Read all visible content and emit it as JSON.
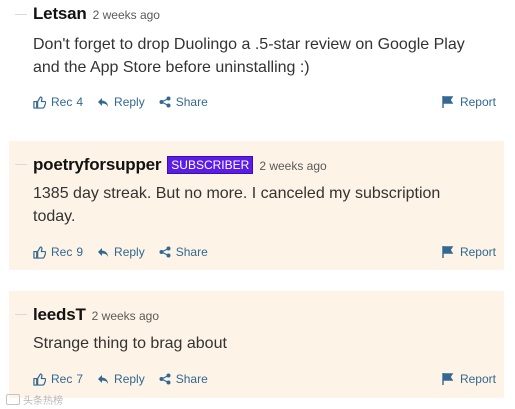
{
  "comments": [
    {
      "username": "Letsan",
      "badge": "",
      "timestamp": "2 weeks ago",
      "text": "Don't forget to drop Duolingo a .5-star review on Google Play and the App Store before uninstalling :)",
      "rec_label": "Rec",
      "rec_count": "4",
      "reply_label": "Reply",
      "share_label": "Share",
      "report_label": "Report"
    },
    {
      "username": "poetryforsupper",
      "badge": "SUBSCRIBER",
      "timestamp": "2 weeks ago",
      "text": "1385 day streak. But no more. I canceled my subscription today.",
      "rec_label": "Rec",
      "rec_count": "9",
      "reply_label": "Reply",
      "share_label": "Share",
      "report_label": "Report"
    },
    {
      "username": "leedsT",
      "badge": "",
      "timestamp": "2 weeks ago",
      "text": "Strange thing to brag about",
      "rec_label": "Rec",
      "rec_count": "7",
      "reply_label": "Reply",
      "share_label": "Share",
      "report_label": "Report"
    }
  ],
  "watermark": "头条热榜",
  "colors": {
    "accent_link": "#326891",
    "subscriber_badge": "#5b1de6",
    "highlight_background": "#fdf3e6"
  },
  "icons": [
    "thumbs-up-icon",
    "reply-arrow-icon",
    "share-icon",
    "flag-icon"
  ]
}
